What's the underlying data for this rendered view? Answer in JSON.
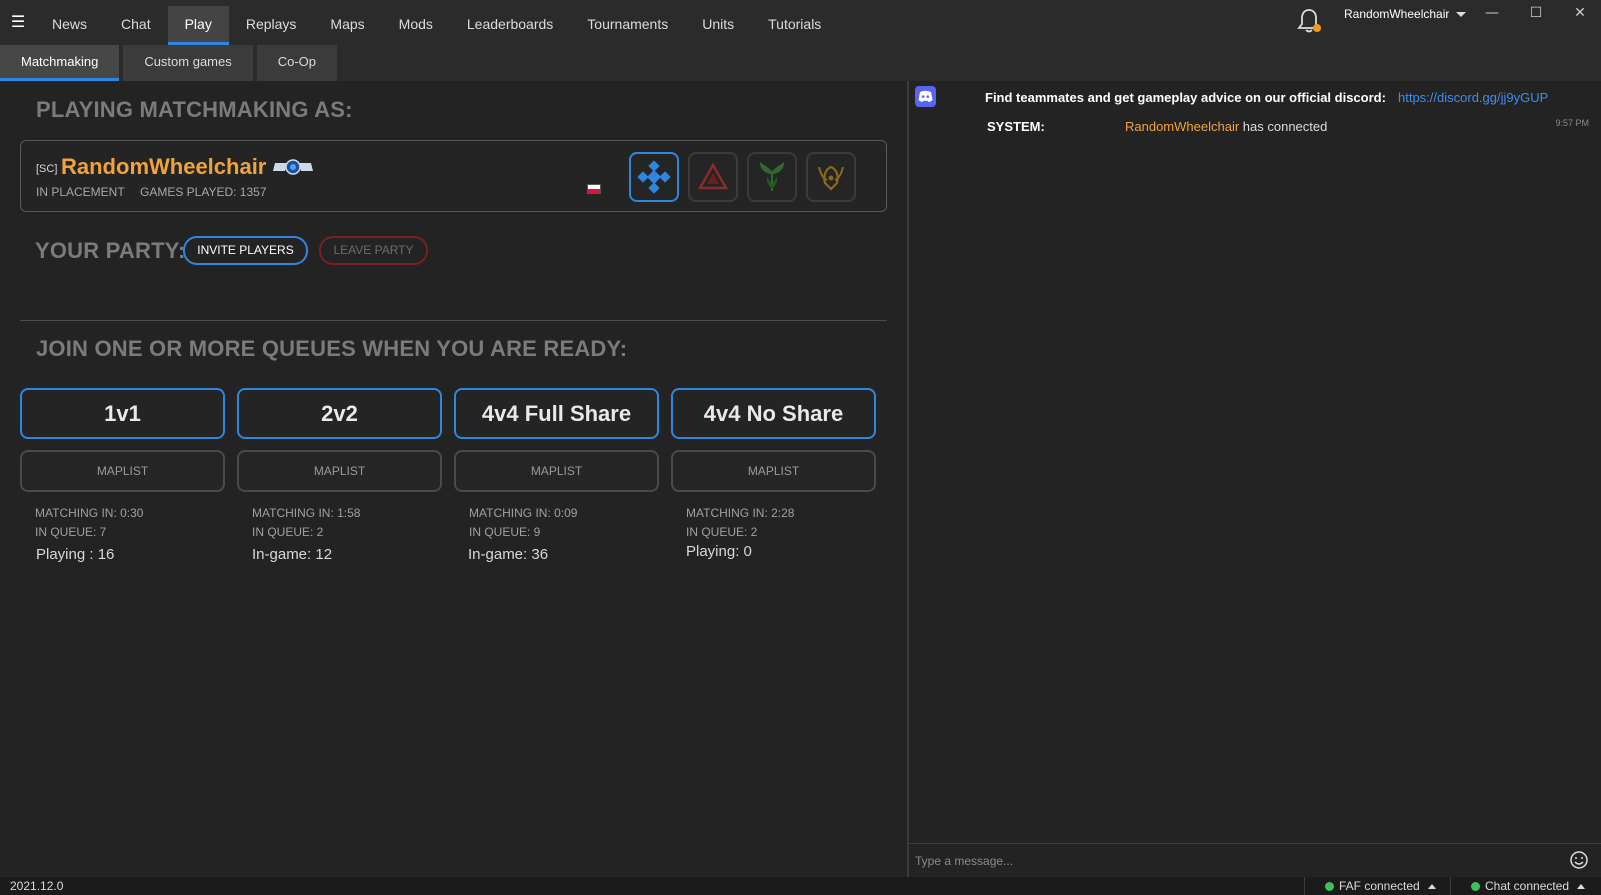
{
  "topbar": {
    "tabs": [
      "News",
      "Chat",
      "Play",
      "Replays",
      "Maps",
      "Mods",
      "Leaderboards",
      "Tournaments",
      "Units",
      "Tutorials"
    ],
    "active_tab": "Play",
    "username": "RandomWheelchair"
  },
  "subtabs": {
    "items": [
      "Matchmaking",
      "Custom games",
      "Co-Op"
    ],
    "active": "Matchmaking"
  },
  "matchmaking": {
    "playing_as_title": "PLAYING MATCHMAKING AS:",
    "player": {
      "clan": "[SC]",
      "name": "RandomWheelchair",
      "placement": "IN PLACEMENT",
      "games_played": "GAMES PLAYED: 1357",
      "factions": [
        {
          "icon": "uef-faction-icon",
          "color": "#2f86e0",
          "selected": true
        },
        {
          "icon": "cybran-faction-icon",
          "color": "#8a2a2a",
          "selected": false
        },
        {
          "icon": "aeon-faction-icon",
          "color": "#2d6b2d",
          "selected": false
        },
        {
          "icon": "seraphim-faction-icon",
          "color": "#8a6a1a",
          "selected": false
        }
      ]
    },
    "party_title": "YOUR PARTY:",
    "invite_label": "INVITE PLAYERS",
    "leave_label": "LEAVE PARTY",
    "queues_title": "JOIN ONE OR MORE QUEUES WHEN YOU ARE READY:",
    "queues": [
      {
        "name": "1v1",
        "maplist": "MAPLIST",
        "matching": "MATCHING IN: 0:30",
        "in_queue": "IN QUEUE: 7",
        "status": "Playing : 16"
      },
      {
        "name": "2v2",
        "maplist": "MAPLIST",
        "matching": "MATCHING IN: 1:58",
        "in_queue": "IN QUEUE: 2",
        "status": "In-game: 12"
      },
      {
        "name": "4v4 Full Share",
        "maplist": "MAPLIST",
        "matching": "MATCHING IN: 0:09",
        "in_queue": "IN QUEUE: 9",
        "status": "In-game: 36"
      },
      {
        "name": "4v4 No Share",
        "maplist": "MAPLIST",
        "matching": "MATCHING IN: 2:28",
        "in_queue": "IN QUEUE: 2",
        "status": "Playing: 0"
      }
    ]
  },
  "chat": {
    "discord_text": "Find teammates and get gameplay advice on our official discord:",
    "discord_link": "https://discord.gg/jj9yGUP",
    "messages": [
      {
        "sender": "SYSTEM:",
        "nick": "RandomWheelchair",
        "text": " has connected",
        "time": "9:57 PM"
      }
    ],
    "input_placeholder": "Type a message..."
  },
  "statusbar": {
    "version": "2021.12.0",
    "faf_status": "FAF connected",
    "chat_status": "Chat connected"
  }
}
